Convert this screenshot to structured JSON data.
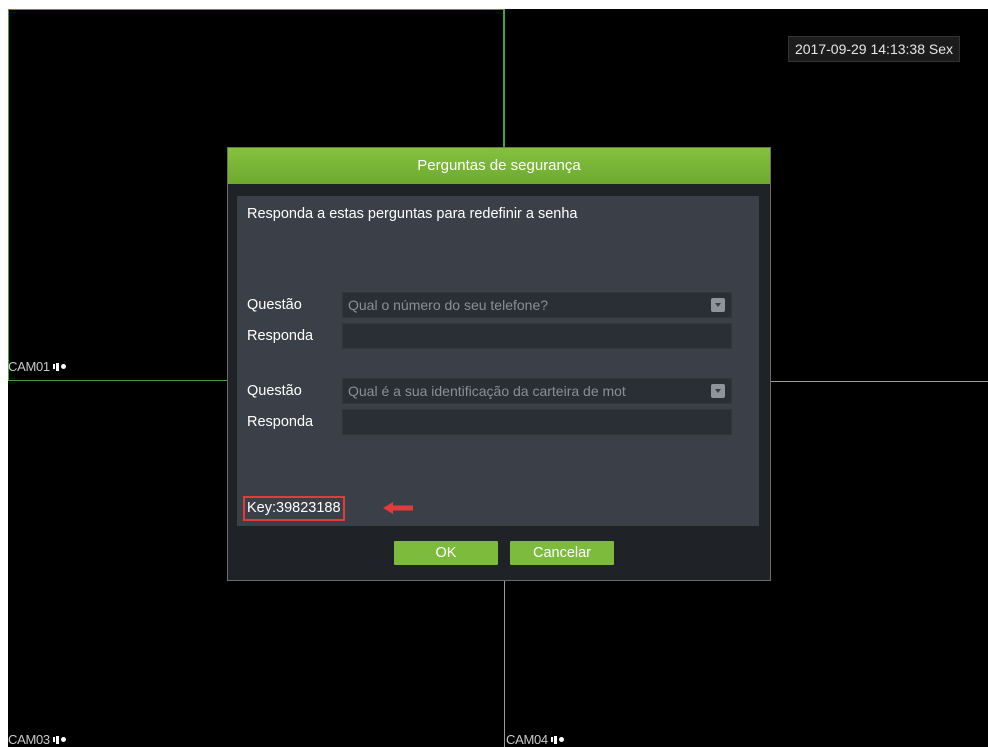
{
  "screen": {
    "datetime": "2017-09-29 14:13:38 Sex",
    "cameras": [
      {
        "label": "CAM01"
      },
      {
        "label": "CAM03"
      },
      {
        "label": "CAM04"
      }
    ]
  },
  "dialog": {
    "title": "Perguntas de segurança",
    "instruction": "Responda a estas perguntas para redefinir a senha",
    "questions": [
      {
        "question_label": "Questão",
        "question_value": "Qual o número do seu telefone?",
        "answer_label": "Responda",
        "answer_value": ""
      },
      {
        "question_label": "Questão",
        "question_value": "Qual é a sua identificação da carteira de mot",
        "answer_label": "Responda",
        "answer_value": ""
      }
    ],
    "key_text": "Key:39823188",
    "ok_label": "OK",
    "cancel_label": "Cancelar"
  },
  "colors": {
    "accent_green": "#7cbb3b",
    "highlight_red": "#e23b3b"
  }
}
